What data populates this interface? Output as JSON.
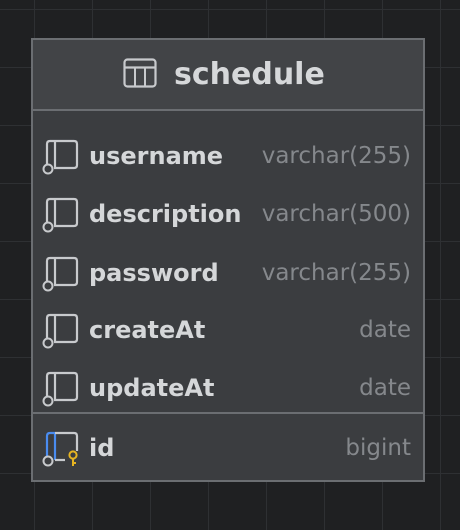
{
  "table": {
    "name": "schedule",
    "columns": [
      {
        "name": "username",
        "type": "varchar(255)",
        "kind": "column",
        "icon": "column-icon"
      },
      {
        "name": "description",
        "type": "varchar(500)",
        "kind": "column",
        "icon": "column-icon"
      },
      {
        "name": "password",
        "type": "varchar(255)",
        "kind": "column",
        "icon": "column-icon"
      },
      {
        "name": "createAt",
        "type": "date",
        "kind": "column",
        "icon": "column-icon"
      },
      {
        "name": "updateAt",
        "type": "date",
        "kind": "column",
        "icon": "column-icon"
      }
    ],
    "primary_key": {
      "name": "id",
      "type": "bigint",
      "kind": "primary-key",
      "icon": "primary-key-column-icon"
    }
  },
  "colors": {
    "canvas_background": "#1f2022",
    "grid_line": "#2e3033",
    "card_background": "#3b3d40",
    "header_background": "#424447",
    "border": "#6b6e72",
    "name_text": "#d5d7d9",
    "type_text": "#85888c",
    "key_accent_blue": "#4a8cf0",
    "key_accent_gold": "#e6b422"
  }
}
